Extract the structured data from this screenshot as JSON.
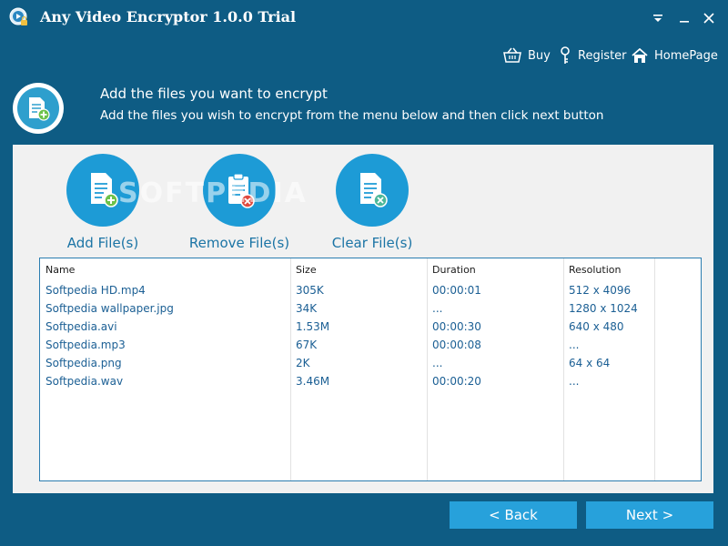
{
  "window": {
    "title": "Any Video Encryptor 1.0.0 Trial"
  },
  "toplinks": {
    "buy": "Buy",
    "register": "Register",
    "homepage": "HomePage"
  },
  "header": {
    "title": "Add the files you want to encrypt",
    "subtitle": "Add the files you wish to encrypt from the menu below and then click next button"
  },
  "actions": {
    "add": "Add File(s)",
    "remove": "Remove File(s)",
    "clear": "Clear File(s)"
  },
  "watermark": "SOFTPEDIA",
  "table": {
    "columns": [
      "Name",
      "Size",
      "Duration",
      "Resolution"
    ],
    "rows": [
      [
        "Softpedia HD.mp4",
        "305K",
        "00:00:01",
        "512 x 4096"
      ],
      [
        "Softpedia wallpaper.jpg",
        "34K",
        "...",
        "1280 x 1024"
      ],
      [
        "Softpedia.avi",
        "1.53M",
        "00:00:30",
        "640 x 480"
      ],
      [
        "Softpedia.mp3",
        "67K",
        "00:00:08",
        "..."
      ],
      [
        "Softpedia.png",
        "2K",
        "...",
        "64 x 64"
      ],
      [
        "Softpedia.wav",
        "3.46M",
        "00:00:20",
        "..."
      ]
    ]
  },
  "nav": {
    "back": "< Back",
    "next": "Next >"
  },
  "colors": {
    "background": "#0e5c84",
    "panel": "#f1f1f1",
    "accent": "#1d9bd6",
    "button": "#27a1db",
    "table_text": "#1b5f94"
  }
}
